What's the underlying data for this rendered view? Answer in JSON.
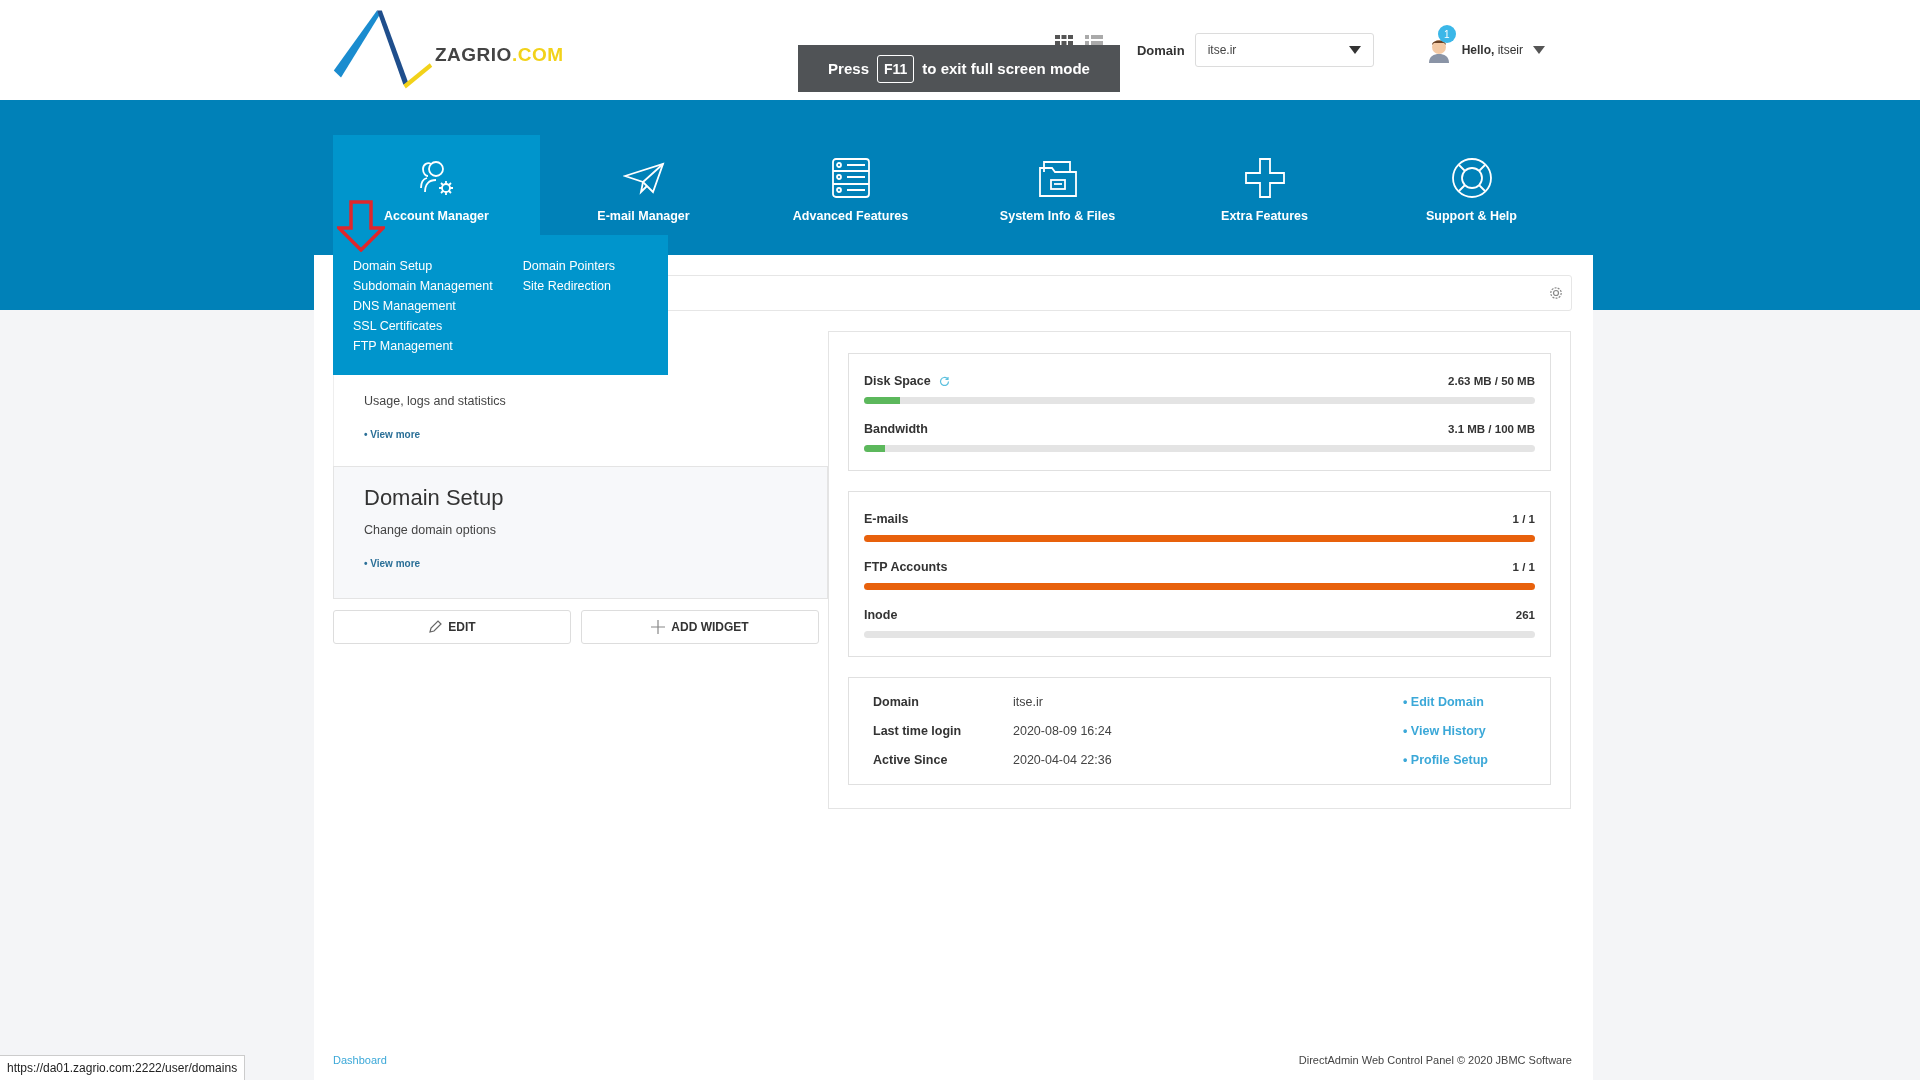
{
  "header": {
    "logo": {
      "name": "ZAGRIO",
      "suffix": ".COM"
    },
    "fullscreen_notice": {
      "before": "Press",
      "key": "F11",
      "after": "to exit full screen mode"
    },
    "domain": {
      "label": "Domain",
      "value": "itse.ir"
    },
    "user": {
      "notifications": "1",
      "greeting": "Hello,",
      "name": "itseir"
    }
  },
  "nav": {
    "items": [
      {
        "label": "Account Manager",
        "selected": true
      },
      {
        "label": "E-mail Manager",
        "selected": false
      },
      {
        "label": "Advanced Features",
        "selected": false
      },
      {
        "label": "System Info & Files",
        "selected": false
      },
      {
        "label": "Extra Features",
        "selected": false
      },
      {
        "label": "Support & Help",
        "selected": false
      }
    ],
    "dropdown": [
      [
        "Domain Setup",
        "Subdomain Management",
        "DNS Management",
        "SSL Certificates",
        "FTP Management"
      ],
      [
        "Domain Pointers",
        "Site Redirection"
      ]
    ]
  },
  "widgets": [
    {
      "description": "Usage, logs and statistics",
      "link": "• View more"
    },
    {
      "title": "Domain Setup",
      "description": "Change domain options",
      "link": "• View more"
    }
  ],
  "widget_buttons": [
    {
      "label": "EDIT"
    },
    {
      "label": "ADD WIDGET"
    }
  ],
  "usage_groups": [
    [
      {
        "label": "Disk Space",
        "reading": "2.63 MB / 50 MB",
        "level": 0.053,
        "color": "#5cb85c"
      },
      {
        "label": "Bandwidth",
        "reading": "3.1 MB / 100 MB",
        "level": 0.031,
        "color": "#5cb85c"
      }
    ],
    [
      {
        "label": "E-mails",
        "reading": "1 / 1",
        "level": 1,
        "color": "#e8610c"
      },
      {
        "label": "FTP Accounts",
        "reading": "1 / 1",
        "level": 1,
        "color": "#e8610c"
      },
      {
        "label": "Inode",
        "reading": "261"
      }
    ]
  ],
  "account_info": [
    {
      "label": "Domain",
      "value": "itse.ir",
      "link": "• Edit Domain"
    },
    {
      "label": "Last time login",
      "value": "2020-08-09 16:24",
      "link": "• View History"
    },
    {
      "label": "Active Since",
      "value": "2020-04-04 22:36",
      "link": "• Profile Setup"
    }
  ],
  "footer": {
    "breadcrumb": "Dashboard",
    "copyright": "DirectAdmin Web Control Panel © 2020 JBMC Software"
  },
  "status_url": "https://da01.zagrio.com:2222/user/domains"
}
